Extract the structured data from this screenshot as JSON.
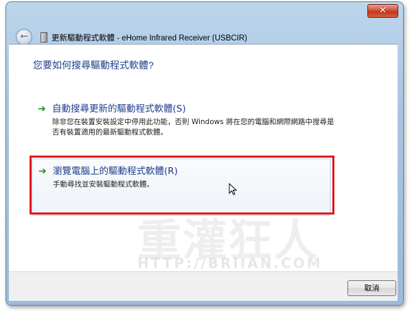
{
  "window": {
    "title": "更新驅動程式軟體 - eHome Infrared Receiver (USBCIR)",
    "close_glyph": "✕",
    "back_glyph": "←"
  },
  "main": {
    "question": "您要如何搜尋驅動程式軟體?",
    "options": [
      {
        "title": "自動搜尋更新的驅動程式軟體(S)",
        "description": "除非您在裝置安裝設定中停用此功能，否則 Windows 將在您的電腦和網際網路中搜尋是否有裝置適用的最新驅動程式軟體。",
        "arrow_glyph": "➔"
      },
      {
        "title": "瀏覽電腦上的驅動程式軟體(R)",
        "description": "手動尋找並安裝驅動程式軟體。",
        "arrow_glyph": "➔"
      }
    ]
  },
  "footer": {
    "cancel_label": "取消"
  },
  "watermark": {
    "logo_text": "重灌狂人",
    "url": "HTTP://BRIIAN.COM"
  },
  "colors": {
    "accent_text": "#1e3d8a",
    "arrow_green": "#1c8d1c",
    "highlight_red": "#e3161d"
  }
}
